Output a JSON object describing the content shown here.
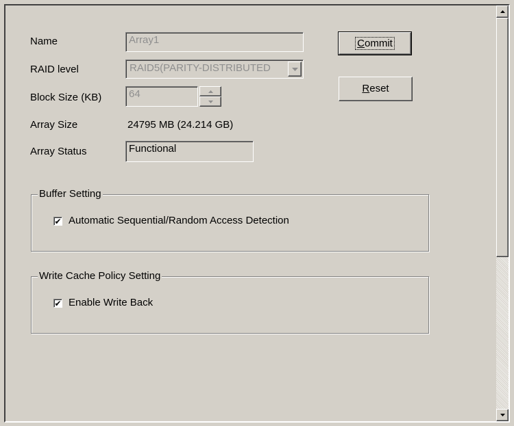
{
  "form": {
    "name": {
      "label": "Name",
      "value": "Array1"
    },
    "raid_level": {
      "label": "RAID level",
      "value": "RAID5(PARITY-DISTRIBUTED"
    },
    "block_size": {
      "label": "Block Size (KB)",
      "value": "64"
    },
    "array_size": {
      "label": "Array Size",
      "value": "24795 MB (24.214 GB)"
    },
    "array_status": {
      "label": "Array Status",
      "value": "Functional"
    }
  },
  "buttons": {
    "commit": {
      "label_first": "C",
      "label_rest": "ommit"
    },
    "reset": {
      "label_first": "R",
      "label_rest": "eset"
    }
  },
  "buffer_setting": {
    "legend": "Buffer Setting",
    "auto_detect": {
      "label": "Automatic Sequential/Random Access Detection",
      "checked": true
    }
  },
  "write_cache": {
    "legend": "Write Cache Policy Setting",
    "write_back": {
      "label": "Enable Write Back",
      "checked": true
    }
  },
  "icons": {
    "scroll_up": "triangle-up",
    "scroll_down": "triangle-down",
    "dropdown": "triangle-down",
    "spin_up": "triangle-up",
    "spin_down": "triangle-down",
    "check": "checkmark"
  },
  "colors": {
    "face": "#d4d0c8",
    "shadow": "#808080",
    "dark_shadow": "#404040",
    "highlight": "#ffffff",
    "disabled_text": "#8f8f8f"
  }
}
